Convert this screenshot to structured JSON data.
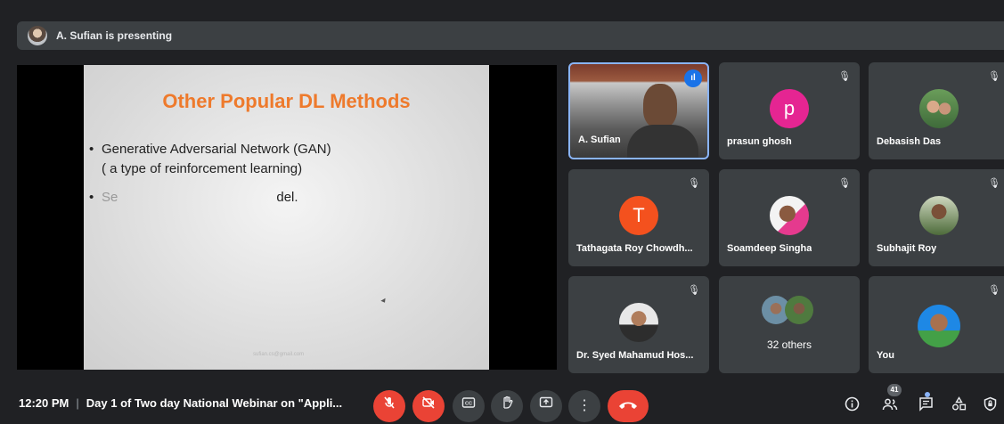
{
  "banner": {
    "presenting_text": "A. Sufian is presenting"
  },
  "slide": {
    "title": "Other Popular DL Methods",
    "bullet1_line1": "Generative Adversarial Network (GAN)",
    "bullet1_line2": "( a type of reinforcement learning)",
    "bullet2_start": "Se",
    "bullet2_end": "del.",
    "bullet_char": "•",
    "email": "sufian.cs@gmail.com"
  },
  "participants": [
    {
      "name": "A. Sufian",
      "speaking": true
    },
    {
      "name": "prasun ghosh",
      "initial": "p",
      "color": "#e52592",
      "muted": true
    },
    {
      "name": "Debasish Das",
      "muted": true
    },
    {
      "name": "Tathagata Roy Chowdh...",
      "initial": "T",
      "color": "#f4511e",
      "muted": true
    },
    {
      "name": "Soamdeep Singha",
      "muted": true
    },
    {
      "name": "Subhajit Roy",
      "muted": true
    },
    {
      "name": "Dr. Syed Mahamud Hos...",
      "muted": true
    },
    {
      "name": "32 others"
    },
    {
      "name": "You",
      "muted": true
    }
  ],
  "icons": {
    "mic_off": "mic-off-icon",
    "speaking": "audio-wave-icon"
  },
  "bottom": {
    "time": "12:20 PM",
    "separator": "|",
    "meeting_title": "Day 1 of Two day National Webinar on \"Appli...",
    "people_count": "41"
  },
  "colors": {
    "accent": "#8ab4f8",
    "danger": "#ea4335",
    "surface": "#3c4043"
  }
}
